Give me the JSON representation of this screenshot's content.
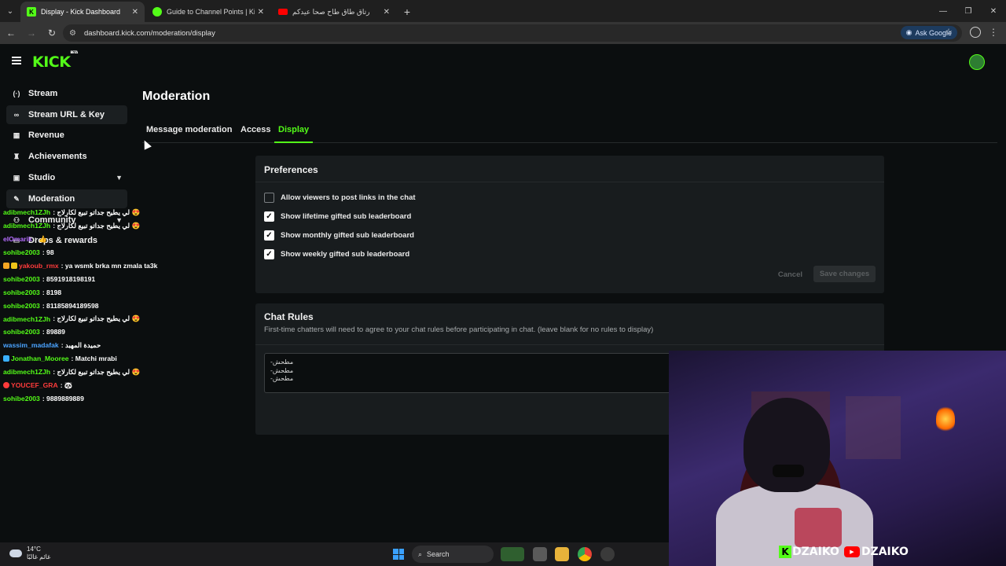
{
  "browser": {
    "tabs": [
      {
        "title": "Display - Kick Dashboard",
        "favicon": "K",
        "favicon_color": "#53fc18",
        "active": true
      },
      {
        "title": "Guide to Channel Points | Kick",
        "favicon": "",
        "favicon_color": "#53fc18",
        "active": false
      },
      {
        "title": "رتاق طاق طاح صحا عيدكم",
        "favicon": "",
        "favicon_color": "#ff0000",
        "active": false
      }
    ],
    "url": "dashboard.kick.com/moderation/display",
    "ask_google": "Ask Google"
  },
  "brand": {
    "logo": "KICK",
    "badge": "BETA"
  },
  "sidebar": {
    "items": [
      {
        "label": "Stream",
        "icon": "broadcast-icon",
        "glyph": "(·)"
      },
      {
        "label": "Stream URL & Key",
        "icon": "link-icon",
        "glyph": "∞"
      },
      {
        "label": "Revenue",
        "icon": "chart-icon",
        "glyph": "▦"
      },
      {
        "label": "Achievements",
        "icon": "trophy-icon",
        "glyph": "♜"
      },
      {
        "label": "Studio",
        "icon": "studio-icon",
        "glyph": "▣"
      },
      {
        "label": "Moderation",
        "icon": "wrench-icon",
        "glyph": "✎"
      },
      {
        "label": "Community",
        "icon": "people-icon",
        "glyph": "⚇"
      },
      {
        "label": "Drops & rewards",
        "icon": "gift-icon",
        "glyph": "▭"
      }
    ]
  },
  "main": {
    "title": "Moderation",
    "tabs": [
      "Message moderation",
      "Access",
      "Display"
    ],
    "preferences": {
      "title": "Preferences",
      "options": [
        {
          "label": "Allow viewers to post links in the chat",
          "checked": false
        },
        {
          "label": "Show lifetime gifted sub leaderboard",
          "checked": true
        },
        {
          "label": "Show monthly gifted sub leaderboard",
          "checked": true
        },
        {
          "label": "Show weekly gifted sub leaderboard",
          "checked": true
        }
      ],
      "cancel": "Cancel",
      "save": "Save changes"
    },
    "chat_rules": {
      "title": "Chat Rules",
      "subtitle": "First-time chatters will need to agree to your chat rules before participating in chat. (leave blank for no rules to display)",
      "lines": [
        "-مطحش",
        "-مطحش",
        "-مطحش"
      ]
    }
  },
  "chat": [
    {
      "user": "adibmech1ZJh",
      "color": "#53fc18",
      "msg": ": لي يطيح جداتو تبيع لكارلاج 😍"
    },
    {
      "user": "adibmech1ZJh",
      "color": "#53fc18",
      "msg": ": لي يطيح جداتو تبيع لكارلاج 😍"
    },
    {
      "user": "elOmarik",
      "color": "#b56cff",
      "msg": ": 👍"
    },
    {
      "user": "sohibe2003",
      "color": "#53fc18",
      "msg": ": 98"
    },
    {
      "user": "yakoub_rmx",
      "color": "#ff3b3b",
      "msg": ": ya wsmk brka mn zmala ta3k"
    },
    {
      "user": "sohibe2003",
      "color": "#53fc18",
      "msg": ": 8591918198191"
    },
    {
      "user": "sohibe2003",
      "color": "#53fc18",
      "msg": ": 8198"
    },
    {
      "user": "sohibe2003",
      "color": "#53fc18",
      "msg": ": 81185894189598"
    },
    {
      "user": "adibmech1ZJh",
      "color": "#53fc18",
      "msg": ": لي يطيح جداتو تبيع لكارلاج 😍"
    },
    {
      "user": "sohibe2003",
      "color": "#53fc18",
      "msg": ": 89889"
    },
    {
      "user": "wassim_madafak",
      "color": "#4aa3ff",
      "msg": ": حميدة المهبد"
    },
    {
      "user": "Jonathan_Mooree",
      "color": "#53fc18",
      "msg": ": Matchi mrabi"
    },
    {
      "user": "adibmech1ZJh",
      "color": "#53fc18",
      "msg": ": لي يطيح جداتو تبيع لكارلاج 😍"
    },
    {
      "user": "YOUCEF_GRA",
      "color": "#ff3b3b",
      "msg": ": 🐼"
    },
    {
      "user": "sohibe2003",
      "color": "#53fc18",
      "msg": ": 9889889889"
    }
  ],
  "overlay": {
    "brand1": "DZAIKO",
    "brand2": "DZAIKO"
  },
  "taskbar": {
    "temp": "14°C",
    "weather": "غائم غالبًا",
    "search": "Search"
  }
}
